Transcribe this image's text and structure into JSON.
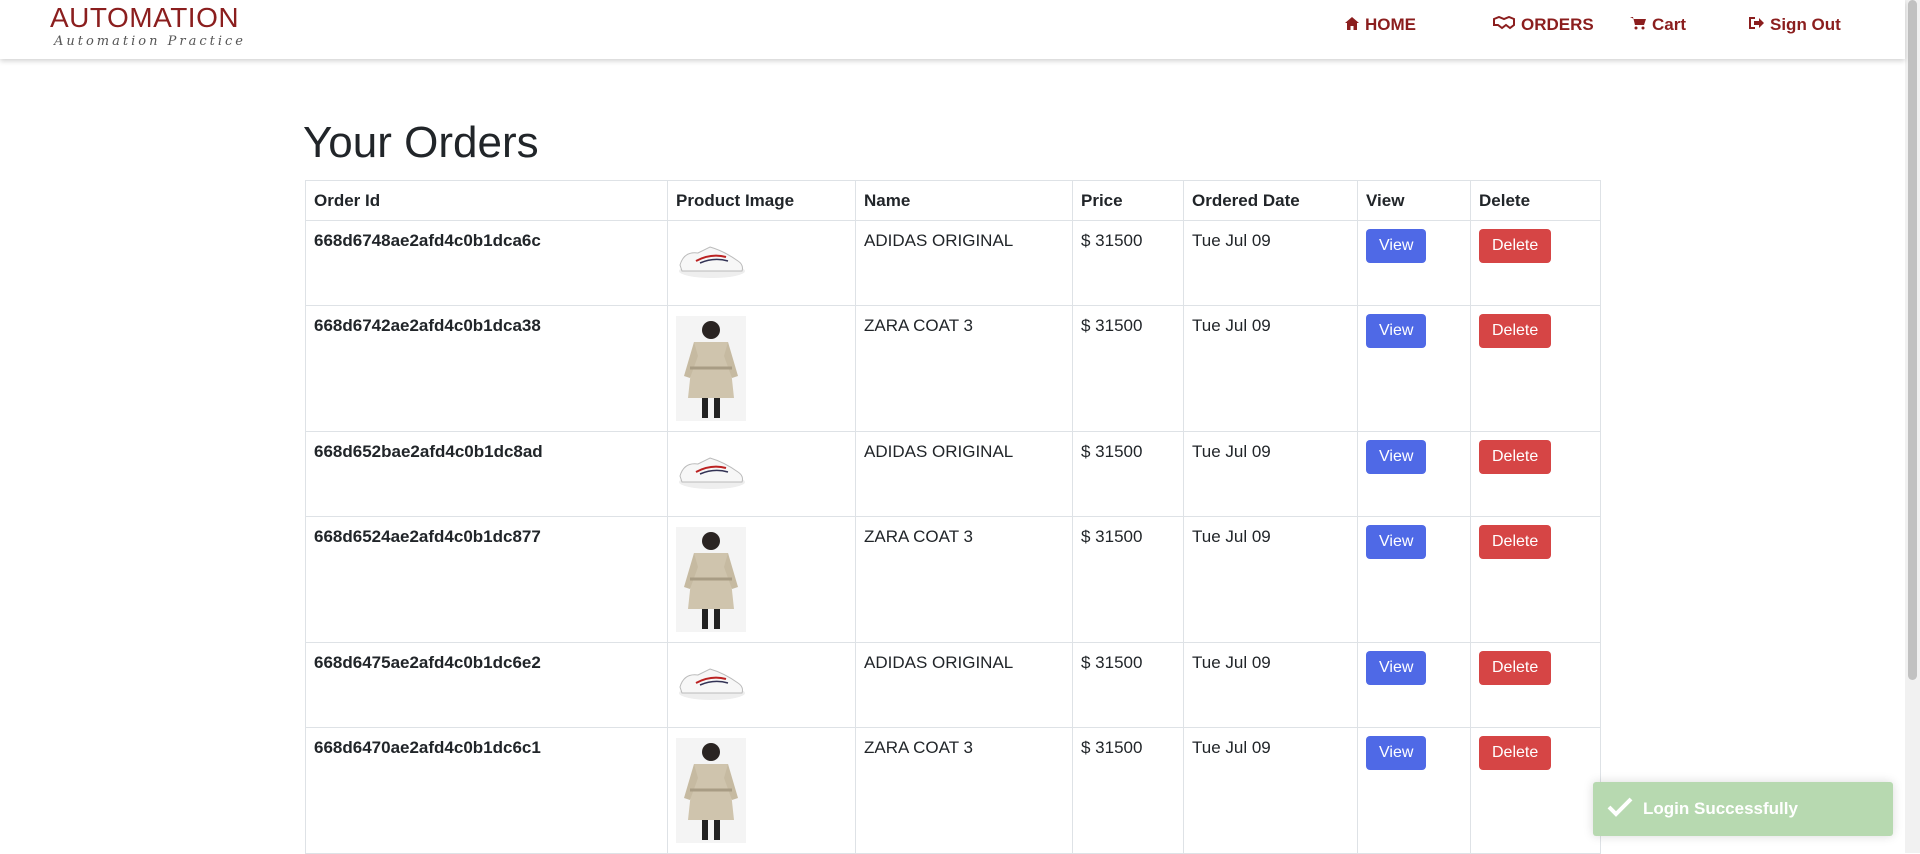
{
  "brand": {
    "title": "AUTOMATION",
    "subtitle": "Automation Practice"
  },
  "nav": {
    "home": "HOME",
    "orders": "ORDERS",
    "cart": "Cart",
    "sign_out": "Sign Out"
  },
  "page_title": "Your Orders",
  "table": {
    "headers": [
      "Order Id",
      "Product Image",
      "Name",
      "Price",
      "Ordered Date",
      "View",
      "Delete"
    ],
    "rows": [
      {
        "order_id": "668d6748ae2afd4c0b1dca6c",
        "product": "shoe",
        "name": "ADIDAS ORIGINAL",
        "price": "$ 31500",
        "date": "Tue Jul 09",
        "view": "View",
        "delete": "Delete"
      },
      {
        "order_id": "668d6742ae2afd4c0b1dca38",
        "product": "coat",
        "name": "ZARA COAT 3",
        "price": "$ 31500",
        "date": "Tue Jul 09",
        "view": "View",
        "delete": "Delete"
      },
      {
        "order_id": "668d652bae2afd4c0b1dc8ad",
        "product": "shoe",
        "name": "ADIDAS ORIGINAL",
        "price": "$ 31500",
        "date": "Tue Jul 09",
        "view": "View",
        "delete": "Delete"
      },
      {
        "order_id": "668d6524ae2afd4c0b1dc877",
        "product": "coat",
        "name": "ZARA COAT 3",
        "price": "$ 31500",
        "date": "Tue Jul 09",
        "view": "View",
        "delete": "Delete"
      },
      {
        "order_id": "668d6475ae2afd4c0b1dc6e2",
        "product": "shoe",
        "name": "ADIDAS ORIGINAL",
        "price": "$ 31500",
        "date": "Tue Jul 09",
        "view": "View",
        "delete": "Delete"
      },
      {
        "order_id": "668d6470ae2afd4c0b1dc6c1",
        "product": "coat",
        "name": "ZARA COAT 3",
        "price": "$ 31500",
        "date": "Tue Jul 09",
        "view": "View",
        "delete": "Delete"
      }
    ]
  },
  "toast": {
    "message": "Login Successfully"
  },
  "colors": {
    "brand": "#8b1e1e",
    "view_button": "#4f69e6",
    "delete_button": "#d64545",
    "toast": "#b7d9b0"
  }
}
